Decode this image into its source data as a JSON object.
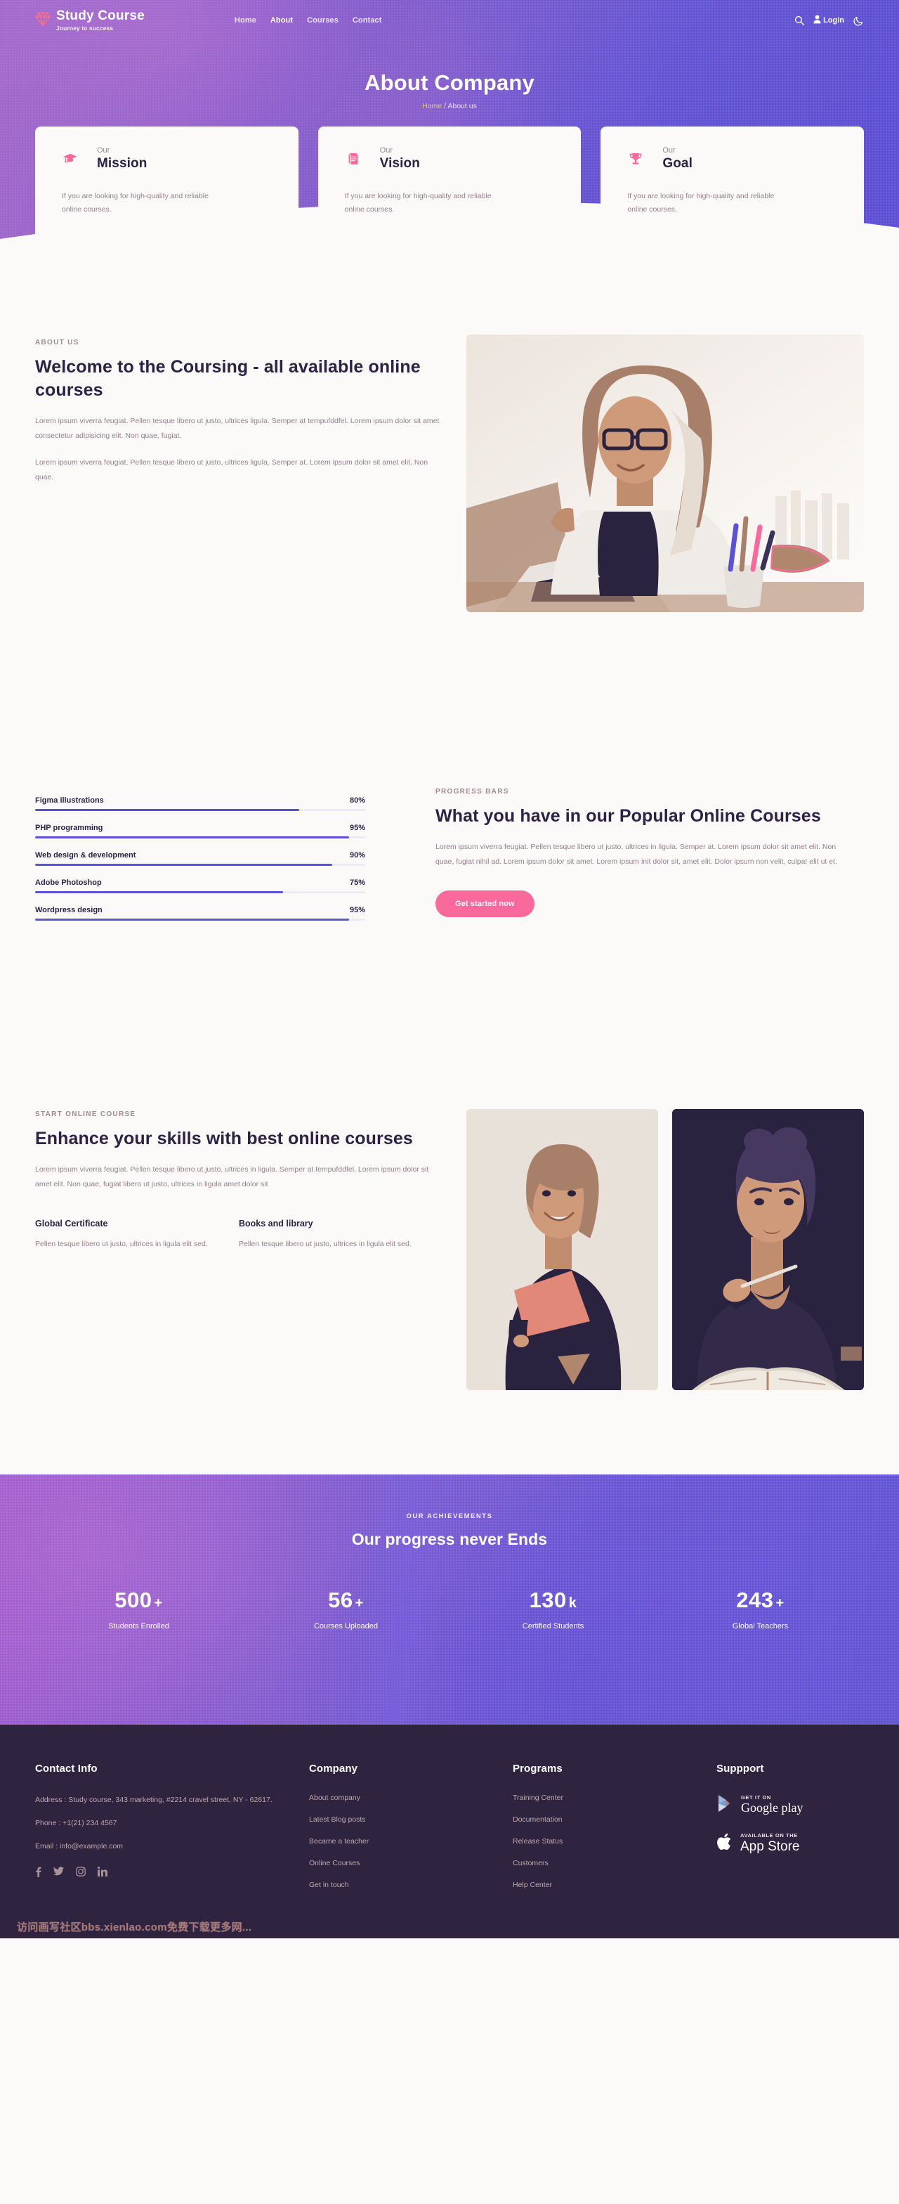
{
  "brand": {
    "name": "Study Course",
    "tagline": "Journey to success",
    "logo_icon": "diamond-icon",
    "logo_color": "#f96f87"
  },
  "nav": {
    "links": [
      {
        "label": "Home",
        "active": false
      },
      {
        "label": "About",
        "active": true
      },
      {
        "label": "Courses",
        "active": false
      },
      {
        "label": "Contact",
        "active": false
      }
    ],
    "search_icon": "search-icon",
    "login_label": "Login",
    "login_icon": "user-icon",
    "theme_icon": "moon-icon"
  },
  "hero": {
    "title": "About Company",
    "breadcrumb_home": "Home",
    "breadcrumb_sep": " / ",
    "breadcrumb_current": "About us"
  },
  "feature_cards": [
    {
      "kicker": "Our",
      "title": "Mission",
      "icon": "graduation-cap-icon",
      "desc": "If you are looking for high-quality and reliable online courses."
    },
    {
      "kicker": "Our",
      "title": "Vision",
      "icon": "book-icon",
      "desc": "If you are looking for high-quality and reliable online courses."
    },
    {
      "kicker": "Our",
      "title": "Goal",
      "icon": "trophy-icon",
      "desc": "If you are looking for high-quality and reliable online courses."
    }
  ],
  "about": {
    "kicker": "ABOUT US",
    "title": "Welcome to the Coursing - all available online courses",
    "paragraph1": "Lorem ipsum viverra feugiat. Pellen tesque libero ut justo, ultrices ligula. Semper at tempufddfel. Lorem ipsum dolor sit amet consectetur adipisicing elit. Non quae, fugiat.",
    "paragraph2": "Lorem ipsum viverra feugiat. Pellen tesque libero ut justo, ultrices ligula. Semper at. Lorem ipsum dolor sit amet elit. Non quae.",
    "image_alt": "woman-with-glasses-at-laptop-photo"
  },
  "progress": {
    "kicker": "PROGRESS BARS",
    "title": "What you have in our Popular Online Courses",
    "paragraph": "Lorem ipsum viverra feugiat. Pellen tesque libero ut justo, ultrices in ligula. Semper at. Lorem ipsum dolor sit amet elit. Non quae, fugiat nihil ad. Lorem ipsum dolor sit amet. Lorem ipsum init dolor sit, amet elit. Dolor ipsum non velit, culpa! elit ut et.",
    "cta_label": "Get started now",
    "cta_color": "#f9699b",
    "bar_color": "#5b51d6",
    "bars": [
      {
        "label": "Figma illustrations",
        "value": 80,
        "value_label": "80%"
      },
      {
        "label": "PHP programming",
        "value": 95,
        "value_label": "95%"
      },
      {
        "label": "Web design & development",
        "value": 90,
        "value_label": "90%"
      },
      {
        "label": "Adobe Photoshop",
        "value": 75,
        "value_label": "75%"
      },
      {
        "label": "Wordpress design",
        "value": 95,
        "value_label": "95%"
      }
    ]
  },
  "skills": {
    "kicker": "START ONLINE COURSE",
    "title": "Enhance your skills with best online courses",
    "paragraph": "Lorem ipsum viverra feugiat. Pellen tesque libero ut justo, ultrices in ligula. Semper at tempufddfel. Lorem ipsum dolor sit amet elit. Non quae, fugiat libero ut justo, ultrices in ligula amet dolor sit",
    "features": [
      {
        "title": "Global Certificate",
        "text": "Pellen tesque libero ut justo, ultrices in ligula elit sed."
      },
      {
        "title": "Books and library",
        "text": "Pellen tesque libero ut justo, ultrices in ligula elit sed."
      }
    ],
    "image1_alt": "smiling-woman-holding-folder-photo",
    "image2_alt": "woman-with-pencil-reading-book-photo"
  },
  "achievements": {
    "kicker": "OUR ACHIEVEMENTS",
    "title": "Our progress never Ends",
    "stats": [
      {
        "number": "500",
        "unit": "+",
        "label": "Students Enrolled"
      },
      {
        "number": "56",
        "unit": "+",
        "label": "Courses Uploaded"
      },
      {
        "number": "130",
        "unit": "k",
        "label": "Certified Students"
      },
      {
        "number": "243",
        "unit": "+",
        "label": "Global Teachers"
      }
    ]
  },
  "footer": {
    "contact": {
      "heading": "Contact Info",
      "address": "Address : Study course, 343 marketing, #2214 cravel street, NY - 62617.",
      "phone": "Phone : +1(21) 234 4567",
      "email": "Email : info@example.com",
      "socials": [
        {
          "name": "facebook-icon"
        },
        {
          "name": "twitter-icon"
        },
        {
          "name": "instagram-icon"
        },
        {
          "name": "linkedin-icon"
        }
      ]
    },
    "company": {
      "heading": "Company",
      "links": [
        "About company",
        "Latest Blog posts",
        "Became a teacher",
        "Online Courses",
        "Get in touch"
      ]
    },
    "programs": {
      "heading": "Programs",
      "links": [
        "Training Center",
        "Documentation",
        "Release Status",
        "Customers",
        "Help Center"
      ]
    },
    "support": {
      "heading": "Suppport",
      "badges": [
        {
          "small": "GET IT ON",
          "big": "Google play",
          "icon": "google-play-icon"
        },
        {
          "small": "AVAILABLE ON THE",
          "big": "App Store",
          "icon": "apple-icon"
        }
      ]
    },
    "watermark": "访问画写社区bbs.xienlao.com免费下载更多网..."
  }
}
